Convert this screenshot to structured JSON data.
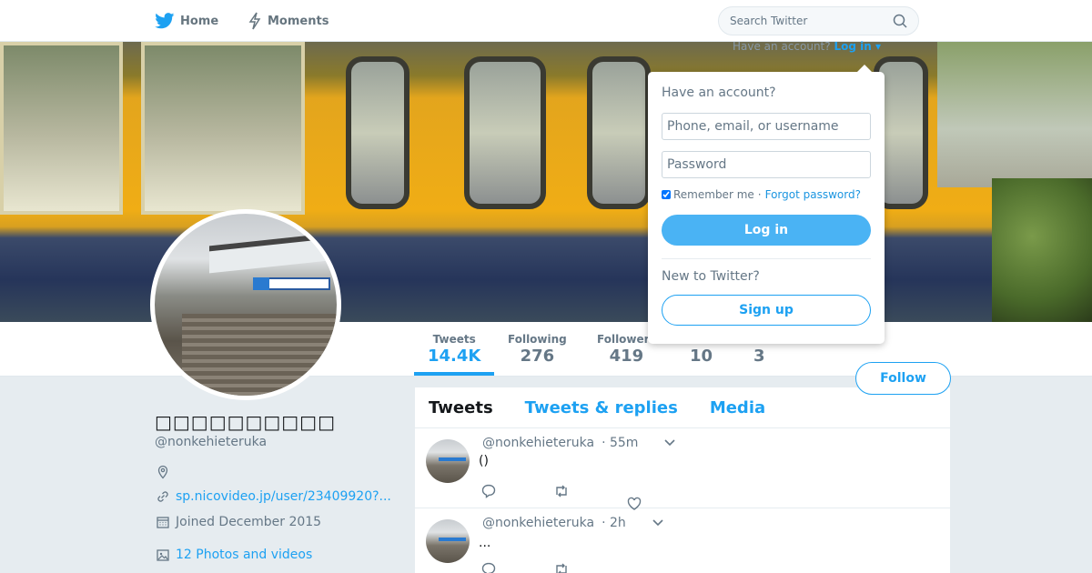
{
  "nav": {
    "home_label": "Home",
    "moments_label": "Moments",
    "search_placeholder": "Search Twitter"
  },
  "login_hint": {
    "text": "Have an account?",
    "link": "Log in"
  },
  "login_dropdown": {
    "title": "Have an account?",
    "username_placeholder": "Phone, email, or username",
    "password_placeholder": "Password",
    "remember_label": "Remember me",
    "separator": "·",
    "forgot_link": "Forgot password?",
    "login_button": "Log in",
    "new_label": "New to Twitter?",
    "signup_button": "Sign up"
  },
  "profile": {
    "name": "□□□□□□□□□□",
    "handle": "@nonkehieteruka",
    "website": "sp.nicovideo.jp/user/23409920?...",
    "joined": "Joined December 2015",
    "media_link": "12 Photos and videos"
  },
  "stats": [
    {
      "label": "Tweets",
      "value": "14.4K"
    },
    {
      "label": "Following",
      "value": "276"
    },
    {
      "label": "Followers",
      "value": "419"
    },
    {
      "label": "",
      "value": "10"
    },
    {
      "label": "",
      "value": "3"
    }
  ],
  "follow_button": "Follow",
  "tabs": [
    "Tweets",
    "Tweets & replies",
    "Media"
  ],
  "tweets": [
    {
      "handle": "@nonkehieteruka",
      "time": "· 55m",
      "text": "()"
    },
    {
      "handle": "@nonkehieteruka",
      "time": "· 2h",
      "text": "..."
    }
  ],
  "colors": {
    "accent": "#1da1f2",
    "login_button": "#4ab3f4"
  }
}
